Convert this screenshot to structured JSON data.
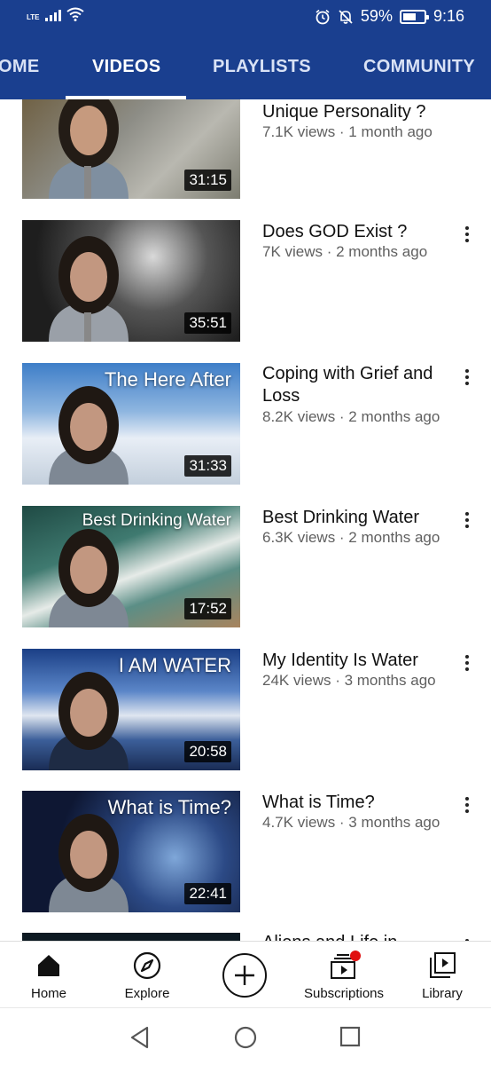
{
  "status": {
    "network": "LTE",
    "battery": "59%",
    "time": "9:16"
  },
  "tabs": [
    {
      "label": "OME"
    },
    {
      "label": "VIDEOS",
      "active": true
    },
    {
      "label": "PLAYLISTS"
    },
    {
      "label": "COMMUNITY"
    }
  ],
  "videos": [
    {
      "title": "Unique Personality ?",
      "meta": "7.1K views · 1 month ago",
      "duration": "31:15",
      "thumb_text": ""
    },
    {
      "title": "Does GOD Exist ?",
      "meta": "7K views · 2 months ago",
      "duration": "35:51",
      "thumb_text": ""
    },
    {
      "title": "Coping with Grief and Loss",
      "meta": "8.2K views · 2 months ago",
      "duration": "31:33",
      "thumb_text": "The Here After"
    },
    {
      "title": "Best Drinking Water",
      "meta": "6.3K views · 2 months ago",
      "duration": "17:52",
      "thumb_text": "Best Drinking Water"
    },
    {
      "title": "My Identity Is Water",
      "meta": "24K views · 3 months ago",
      "duration": "20:58",
      "thumb_text": "I AM WATER"
    },
    {
      "title": "What is Time?",
      "meta": "4.7K views · 3 months ago",
      "duration": "22:41",
      "thumb_text": "What is Time?"
    },
    {
      "title": "Aliens and Life in",
      "meta": "",
      "duration": "",
      "thumb_text": ""
    }
  ],
  "bottom_nav": {
    "home": "Home",
    "explore": "Explore",
    "subscriptions": "Subscriptions",
    "library": "Library"
  },
  "icons": {
    "home": "home-icon",
    "explore": "compass-icon",
    "create": "plus-circle-icon",
    "subscriptions": "subscriptions-icon",
    "library": "library-icon"
  },
  "colors": {
    "header": "#1a3f8f",
    "notification_dot": "#e01010"
  }
}
